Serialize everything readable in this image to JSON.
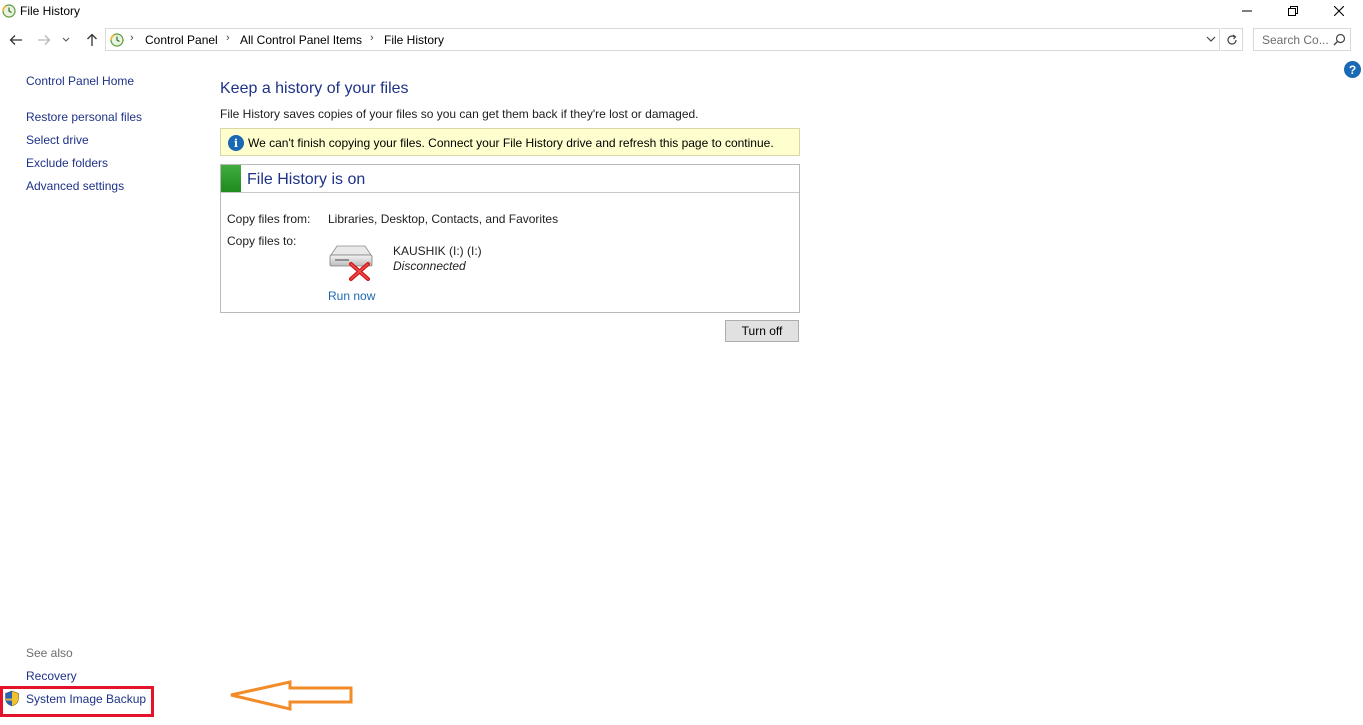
{
  "window": {
    "title": "File History",
    "minimize_icon": "minimize-icon",
    "maximize_icon": "restore-icon",
    "close_icon": "close-icon"
  },
  "addressbar": {
    "breadcrumbs": [
      "Control Panel",
      "All Control Panel Items",
      "File History"
    ],
    "search_placeholder": "Search Co..."
  },
  "leftpane": {
    "home": "Control Panel Home",
    "links": [
      "Restore personal files",
      "Select drive",
      "Exclude folders",
      "Advanced settings"
    ],
    "see_also_label": "See also",
    "see_also": [
      "Recovery",
      "System Image Backup"
    ]
  },
  "main": {
    "title": "Keep a history of your files",
    "description": "File History saves copies of your files so you can get them back if they're lost or damaged.",
    "info_message": "We can't finish copying your files. Connect your File History drive and refresh this page to continue.",
    "status_title": "File History is on",
    "copy_from_label": "Copy files from:",
    "copy_from_value": "Libraries, Desktop, Contacts, and Favorites",
    "copy_to_label": "Copy files to:",
    "drive_name": "KAUSHIK (I:) (I:)",
    "drive_status": "Disconnected",
    "run_now": "Run now",
    "turn_off": "Turn off"
  },
  "colors": {
    "link": "#1e3287",
    "accent_blue": "#1a69b4",
    "info_bg": "#fefece",
    "status_green": "#2e9e2e",
    "highlight_red": "#e2132a",
    "annotation_orange": "#f28c28"
  }
}
